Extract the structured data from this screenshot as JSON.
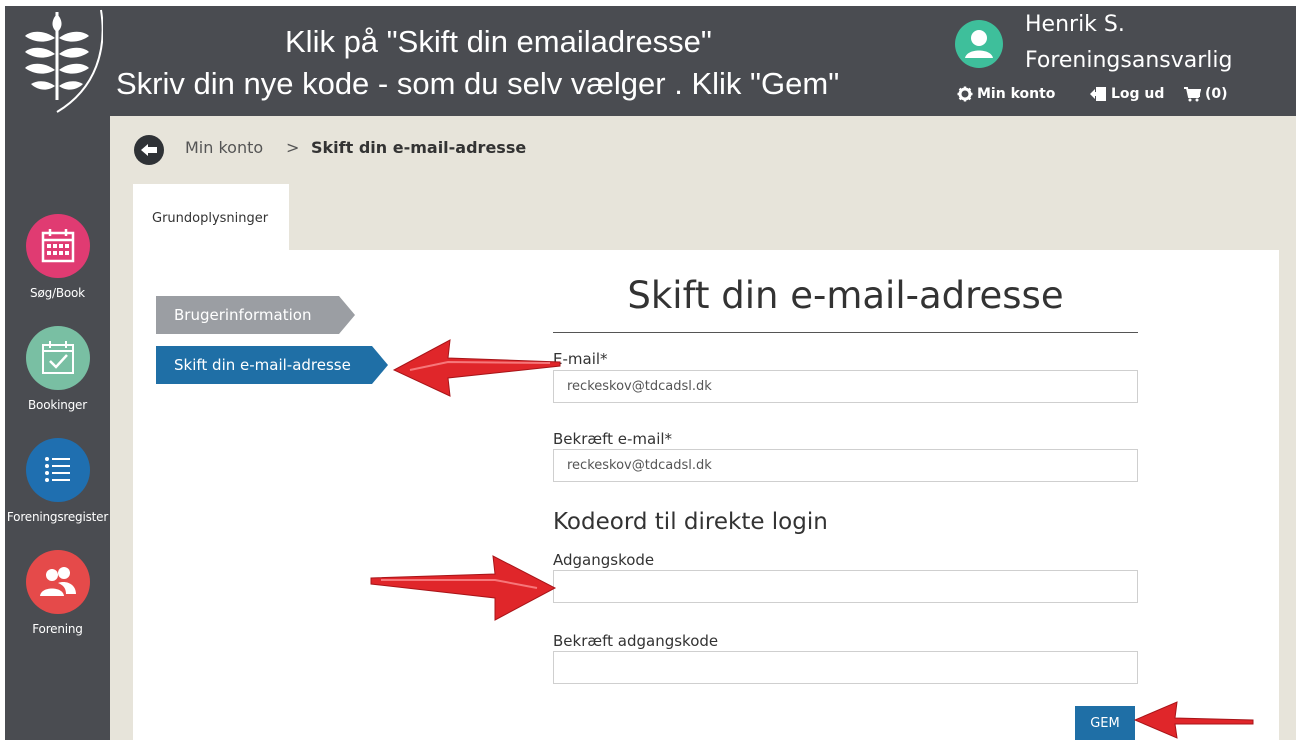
{
  "header": {
    "instruction_line1": "Klik på \"Skift din emailadresse\"",
    "instruction_line2": "Skriv din nye kode - som du selv vælger . Klik \"Gem\"",
    "user_name": "Henrik S.",
    "user_role": "Foreningsansvarlig",
    "nav": {
      "account_label": "Min konto",
      "logout_label": "Log ud",
      "cart_label": "(0)"
    }
  },
  "sidebar": {
    "items": [
      {
        "label": "Søg/Book",
        "icon": "calendar-icon",
        "color": "#e03b72"
      },
      {
        "label": "Bookinger",
        "icon": "calendar-check-icon",
        "color": "#79bfa3"
      },
      {
        "label": "Foreningsregister",
        "icon": "list-icon",
        "color": "#1f6fb0"
      },
      {
        "label": "Forening",
        "icon": "people-icon",
        "color": "#e54a4a"
      }
    ]
  },
  "breadcrumb": {
    "root": "Min konto",
    "separator": ">",
    "current": "Skift din e-mail-adresse"
  },
  "tab": {
    "label": "Grundoplysninger"
  },
  "steps": {
    "info": "Brugerinformation",
    "email": "Skift din e-mail-adresse"
  },
  "form": {
    "title": "Skift din e-mail-adresse",
    "email_label": "E-mail*",
    "email_value": "reckeskov@tdcadsl.dk",
    "confirm_email_label": "Bekræft e-mail*",
    "confirm_email_value": "reckeskov@tdcadsl.dk",
    "section_title": "Kodeord til direkte login",
    "password_label": "Adgangskode",
    "password_value": "",
    "confirm_password_label": "Bekræft adgangskode",
    "confirm_password_value": "",
    "save_label": "GEM"
  },
  "colors": {
    "dark_bar": "#4a4c51",
    "background": "#e7e4da",
    "primary_blue": "#1f6fa6",
    "step_gray": "#9b9ea3",
    "avatar_green": "#3ebf9b",
    "annotation_arrow": "#e0262a"
  }
}
